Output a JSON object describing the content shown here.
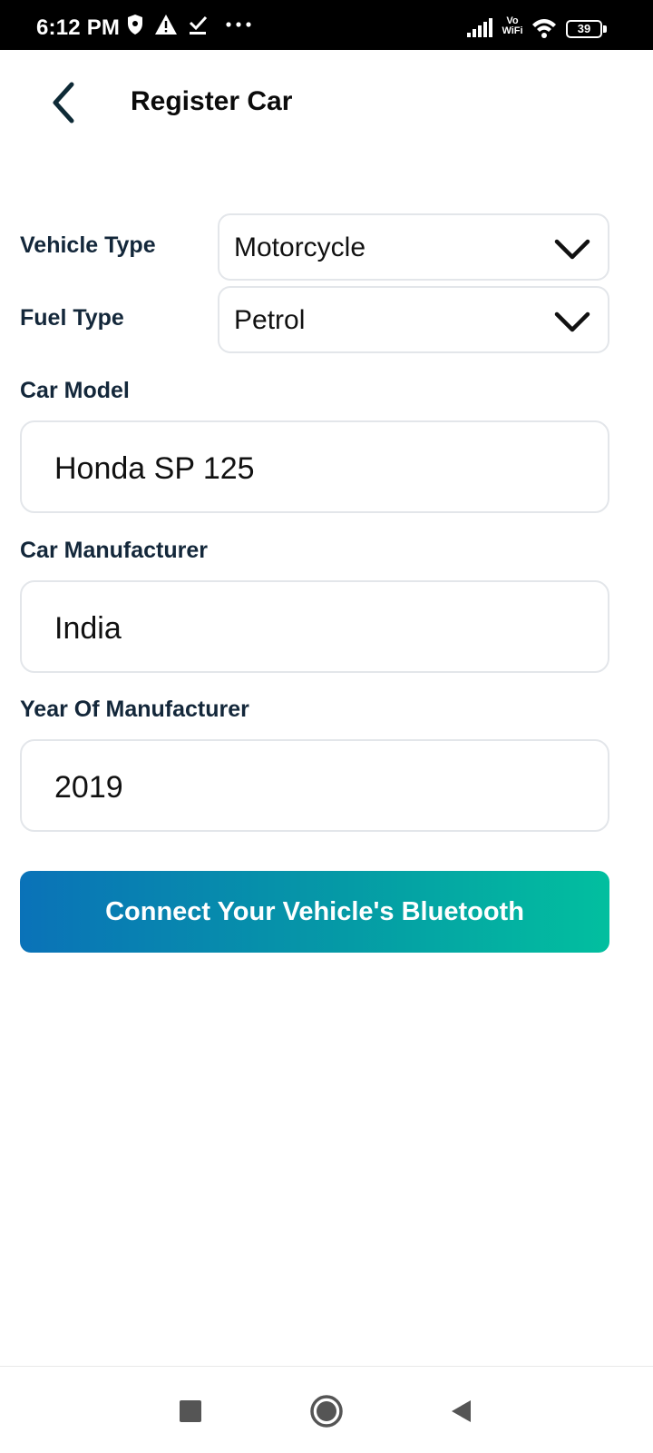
{
  "status_bar": {
    "time": "6:12 PM",
    "battery": "39",
    "icons": [
      "shield-icon",
      "alert-icon",
      "download-check-icon",
      "more-dots-icon",
      "signal-icon",
      "vowifi-icon",
      "wifi-icon",
      "battery-icon"
    ],
    "vowifi_top": "Vo",
    "vowifi_bottom": "WiFi"
  },
  "header": {
    "title": "Register Car",
    "back_icon": "chevron-left-icon"
  },
  "form": {
    "vehicle_type": {
      "label": "Vehicle Type",
      "value": "Motorcycle"
    },
    "fuel_type": {
      "label": "Fuel Type",
      "value": "Petrol"
    },
    "car_model": {
      "label": "Car Model",
      "value": "Honda SP 125"
    },
    "car_manufacturer": {
      "label": "Car Manufacturer",
      "value": "India"
    },
    "year_of_manufacturer": {
      "label": "Year Of Manufacturer",
      "value": "2019"
    }
  },
  "cta": {
    "label": "Connect Your Vehicle's Bluetooth",
    "gradient_start": "#0a72b8",
    "gradient_end": "#02bf9f"
  },
  "nav_bar": {
    "icons": [
      "recents-square-icon",
      "home-circle-icon",
      "back-triangle-icon"
    ]
  },
  "colors": {
    "text_dark": "#13273a",
    "border": "#e3e6ea",
    "status_bar_bg": "#000000"
  }
}
